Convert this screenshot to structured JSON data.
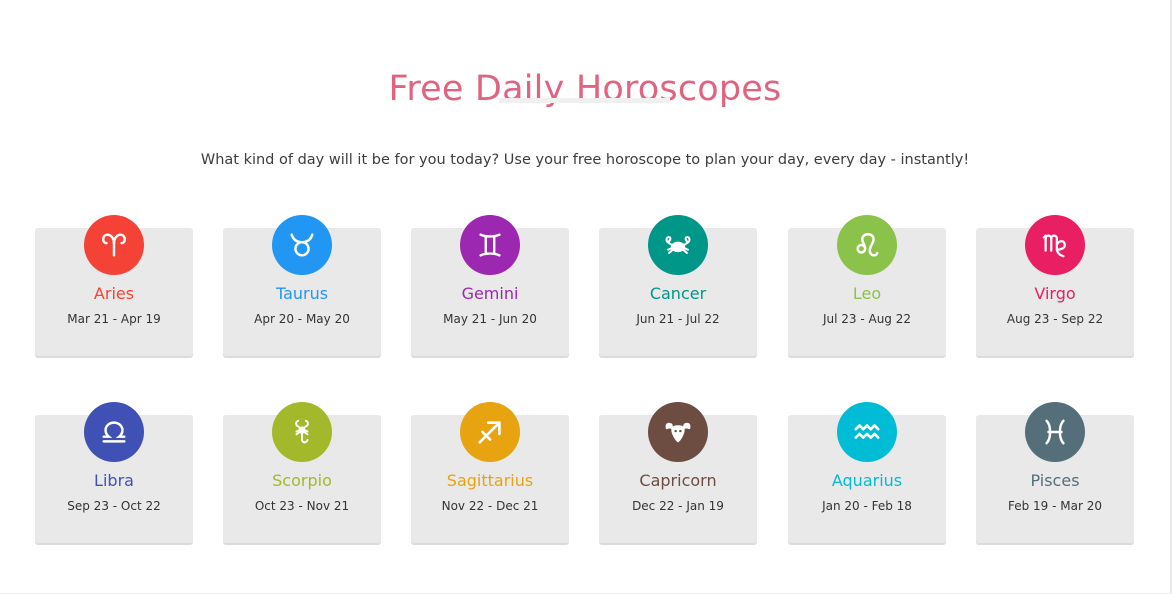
{
  "header": {
    "title": "Free Daily Horoscopes",
    "subtitle": "What kind of day will it be for you today? Use your free horoscope to plan your day, every day - instantly!"
  },
  "signs": [
    {
      "name": "Aries",
      "dates": "Mar 21 - Apr 19",
      "color": "#f44336",
      "icon": "aries-icon"
    },
    {
      "name": "Taurus",
      "dates": "Apr 20 - May 20",
      "color": "#2196f3",
      "icon": "taurus-icon"
    },
    {
      "name": "Gemini",
      "dates": "May 21 - Jun 20",
      "color": "#9c27b0",
      "icon": "gemini-icon"
    },
    {
      "name": "Cancer",
      "dates": "Jun 21 - Jul 22",
      "color": "#009688",
      "icon": "cancer-icon"
    },
    {
      "name": "Leo",
      "dates": "Jul 23 - Aug 22",
      "color": "#8bc34a",
      "icon": "leo-icon"
    },
    {
      "name": "Virgo",
      "dates": "Aug 23 - Sep 22",
      "color": "#e91e63",
      "icon": "virgo-icon"
    },
    {
      "name": "Libra",
      "dates": "Sep 23 - Oct 22",
      "color": "#3f51b5",
      "icon": "libra-icon"
    },
    {
      "name": "Scorpio",
      "dates": "Oct 23 - Nov 21",
      "color": "#a4b82c",
      "icon": "scorpio-icon"
    },
    {
      "name": "Sagittarius",
      "dates": "Nov 22 - Dec 21",
      "color": "#e8a311",
      "icon": "sagittarius-icon"
    },
    {
      "name": "Capricorn",
      "dates": "Dec 22 - Jan 19",
      "color": "#6d4c41",
      "icon": "capricorn-icon"
    },
    {
      "name": "Aquarius",
      "dates": "Jan 20 - Feb 18",
      "color": "#00bcd4",
      "icon": "aquarius-icon"
    },
    {
      "name": "Pisces",
      "dates": "Feb 19 - Mar 20",
      "color": "#546e7a",
      "icon": "pisces-icon"
    }
  ]
}
